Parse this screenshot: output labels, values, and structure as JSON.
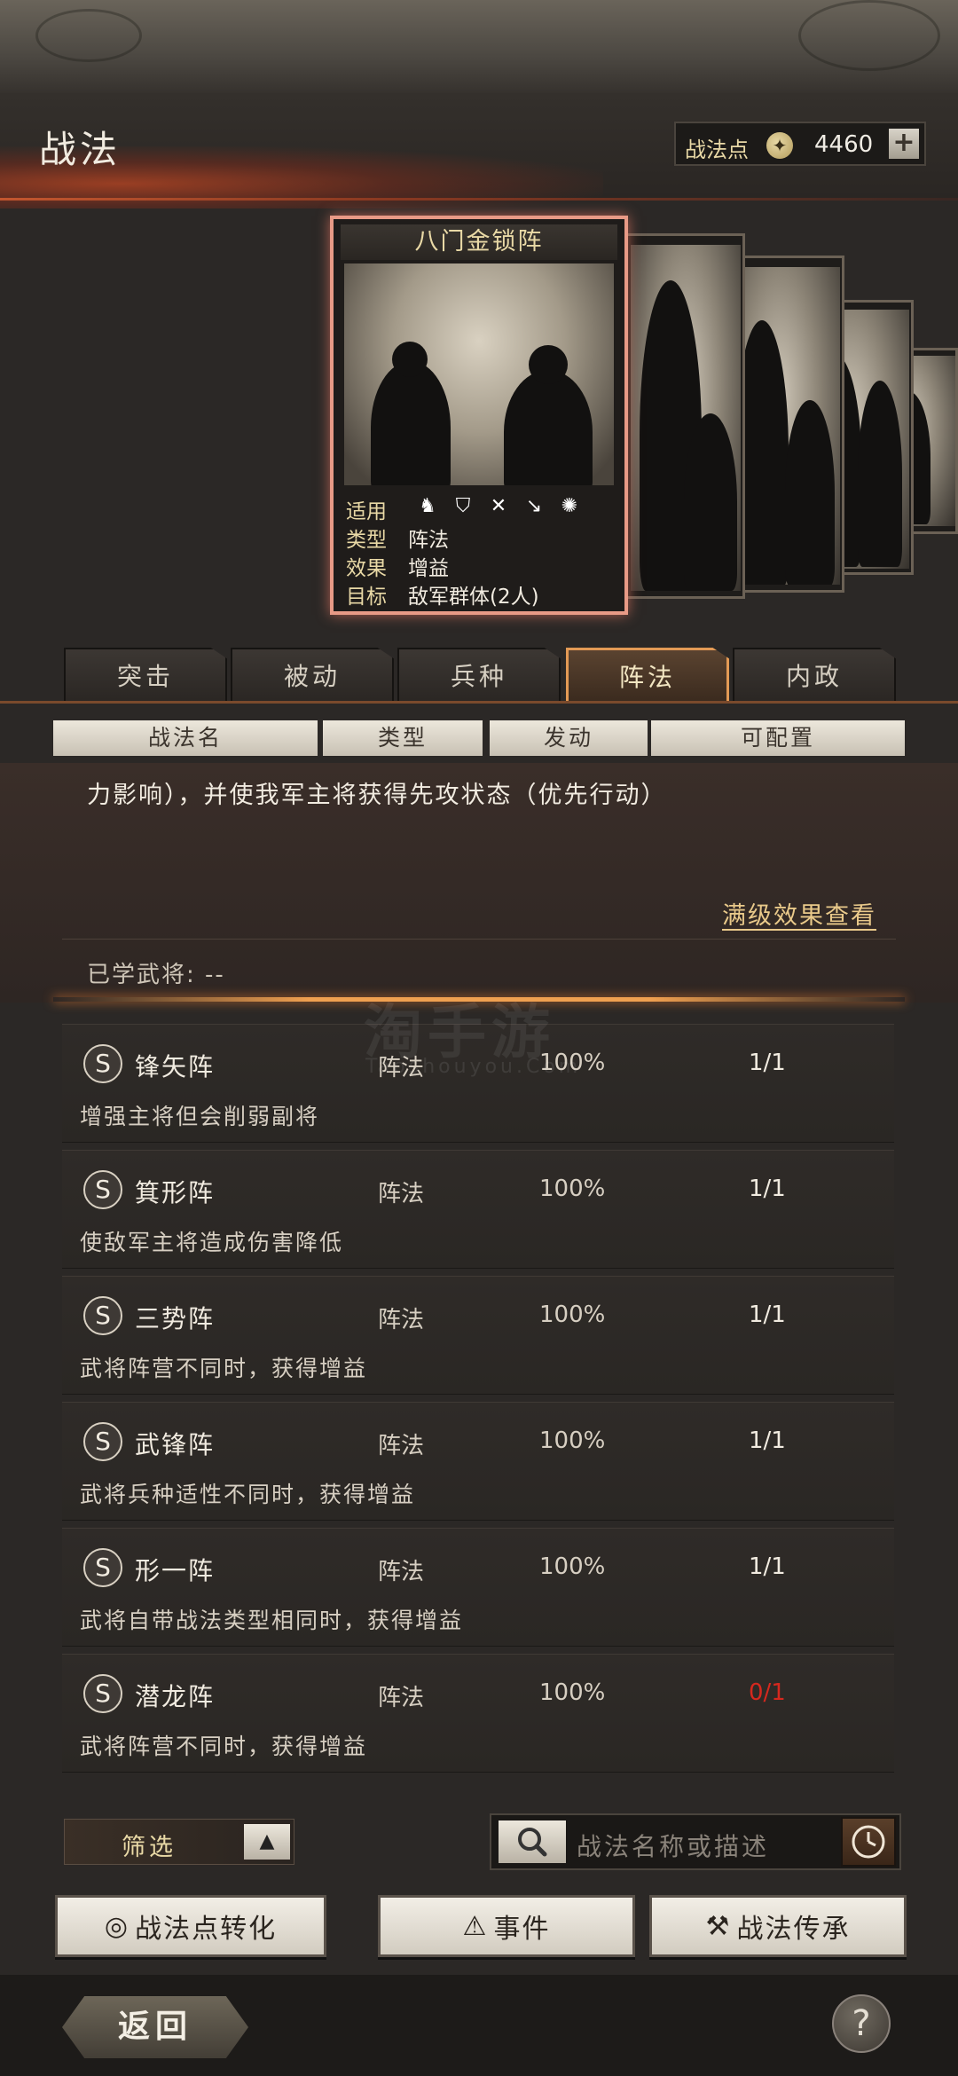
{
  "header": {
    "title": "战法",
    "points_label": "战法点",
    "points_value": "4460",
    "plus_symbol": "+"
  },
  "featured_card": {
    "name": "八门金锁阵",
    "rows": [
      {
        "key": "适用",
        "value": ""
      },
      {
        "key": "类型",
        "value": "阵法"
      },
      {
        "key": "效果",
        "value": "增益"
      },
      {
        "key": "目标",
        "value": "敌军群体(2人)"
      }
    ],
    "troop_icons": [
      "cavalry-icon",
      "shield-icon",
      "bow-icon",
      "spear-icon",
      "wheel-icon"
    ]
  },
  "tabs": [
    {
      "label": "突击",
      "active": false
    },
    {
      "label": "被动",
      "active": false
    },
    {
      "label": "兵种",
      "active": false
    },
    {
      "label": "阵法",
      "active": true
    },
    {
      "label": "内政",
      "active": false
    }
  ],
  "columns": [
    "战法名",
    "类型",
    "发动",
    "可配置"
  ],
  "detail": {
    "description": "力影响），并使我军主将获得先攻状态（优先行动）",
    "full_effect_link": "满级效果查看",
    "learned_label": "已学武将: --"
  },
  "watermark": {
    "main": "淘手游",
    "sub": "Taoshouyou.Com"
  },
  "skills": [
    {
      "badge": "S",
      "name": "锋矢阵",
      "type": "阵法",
      "rate": "100%",
      "slots": "1/1",
      "desc": "增强主将但会削弱副将",
      "empty": false
    },
    {
      "badge": "S",
      "name": "箕形阵",
      "type": "阵法",
      "rate": "100%",
      "slots": "1/1",
      "desc": "使敌军主将造成伤害降低",
      "empty": false
    },
    {
      "badge": "S",
      "name": "三势阵",
      "type": "阵法",
      "rate": "100%",
      "slots": "1/1",
      "desc": "武将阵营不同时，获得增益",
      "empty": false
    },
    {
      "badge": "S",
      "name": "武锋阵",
      "type": "阵法",
      "rate": "100%",
      "slots": "1/1",
      "desc": "武将兵种适性不同时，获得增益",
      "empty": false
    },
    {
      "badge": "S",
      "name": "形一阵",
      "type": "阵法",
      "rate": "100%",
      "slots": "1/1",
      "desc": "武将自带战法类型相同时，获得增益",
      "empty": false
    },
    {
      "badge": "S",
      "name": "潜龙阵",
      "type": "阵法",
      "rate": "100%",
      "slots": "0/1",
      "desc": "武将阵营不同时，获得增益",
      "empty": true
    }
  ],
  "controls": {
    "filter_label": "筛选",
    "search_placeholder": "战法名称或描述",
    "buttons": {
      "convert": "战法点转化",
      "events": "事件",
      "inherit": "战法传承"
    },
    "back": "返回",
    "help": "?"
  },
  "colors": {
    "accent_orange": "#e39a55",
    "empty_slot_red": "#d5281e",
    "gold_text": "#e9d9a6"
  }
}
